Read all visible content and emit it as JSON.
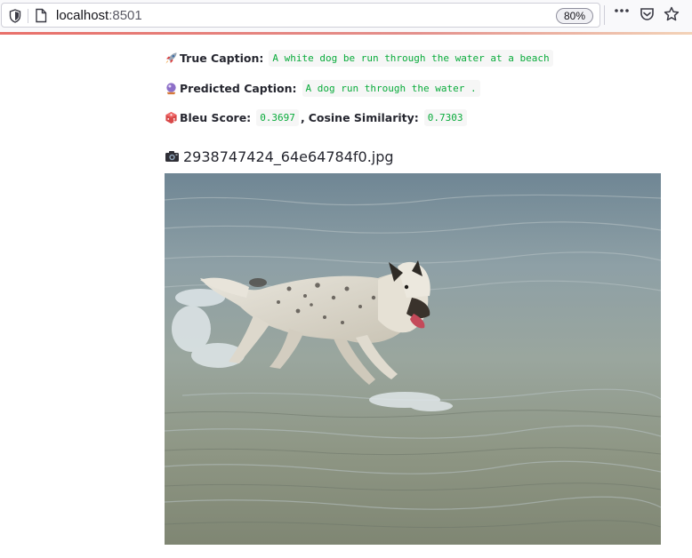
{
  "browser": {
    "url_host": "localhost",
    "url_port": ":8501",
    "zoom_label": "80%"
  },
  "result": {
    "true_caption_label": "True Caption:",
    "true_caption_value": "A white dog be run through the water at a beach",
    "predicted_caption_label": "Predicted Caption:",
    "predicted_caption_value": "A dog run through the water .",
    "bleu_label": "Bleu Score:",
    "bleu_value": "0.3697",
    "separator": ",",
    "cosine_label": "Cosine Similarity:",
    "cosine_value": "0.7303"
  },
  "image": {
    "filename": "2938747424_64e64784f0.jpg"
  },
  "icons": {
    "true_caption": "rocket-icon",
    "predicted_caption": "crystal-ball-icon",
    "bleu": "die-icon",
    "filename": "camera-icon",
    "toolbar": [
      "shield-icon",
      "page-icon",
      "overflow-icon",
      "pocket-icon",
      "star-icon"
    ]
  },
  "colors": {
    "code_text": "#09ab3b",
    "code_bg": "#f6f6f6",
    "text": "#262730",
    "accent": "#e8706a"
  }
}
